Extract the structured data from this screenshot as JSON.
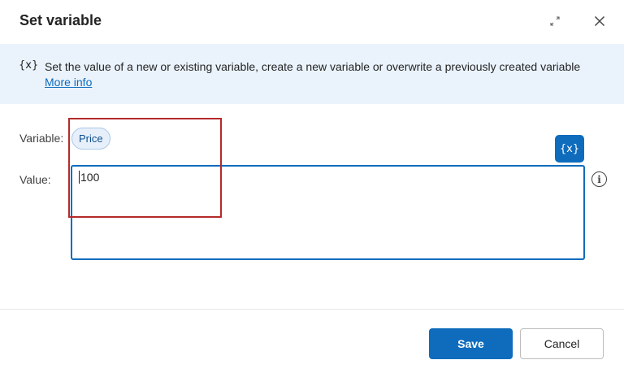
{
  "dialog": {
    "title": "Set variable",
    "expand_icon": "expand-diagonal-icon",
    "close_icon": "close-icon"
  },
  "info": {
    "icon_glyph": "{x}",
    "text": "Set the value of a new or existing variable, create a new variable or overwrite a previously created variable",
    "link": "More info"
  },
  "form": {
    "variable_label": "Variable:",
    "variable_name": "Price",
    "value_label": "Value:",
    "value": "100",
    "insert_variable_glyph": "{x}",
    "help_icon_glyph": "i"
  },
  "footer": {
    "save_label": "Save",
    "cancel_label": "Cancel"
  },
  "colors": {
    "accent": "#0f6cbd",
    "banner": "#eaf3fc",
    "highlight": "#b52a2a"
  }
}
